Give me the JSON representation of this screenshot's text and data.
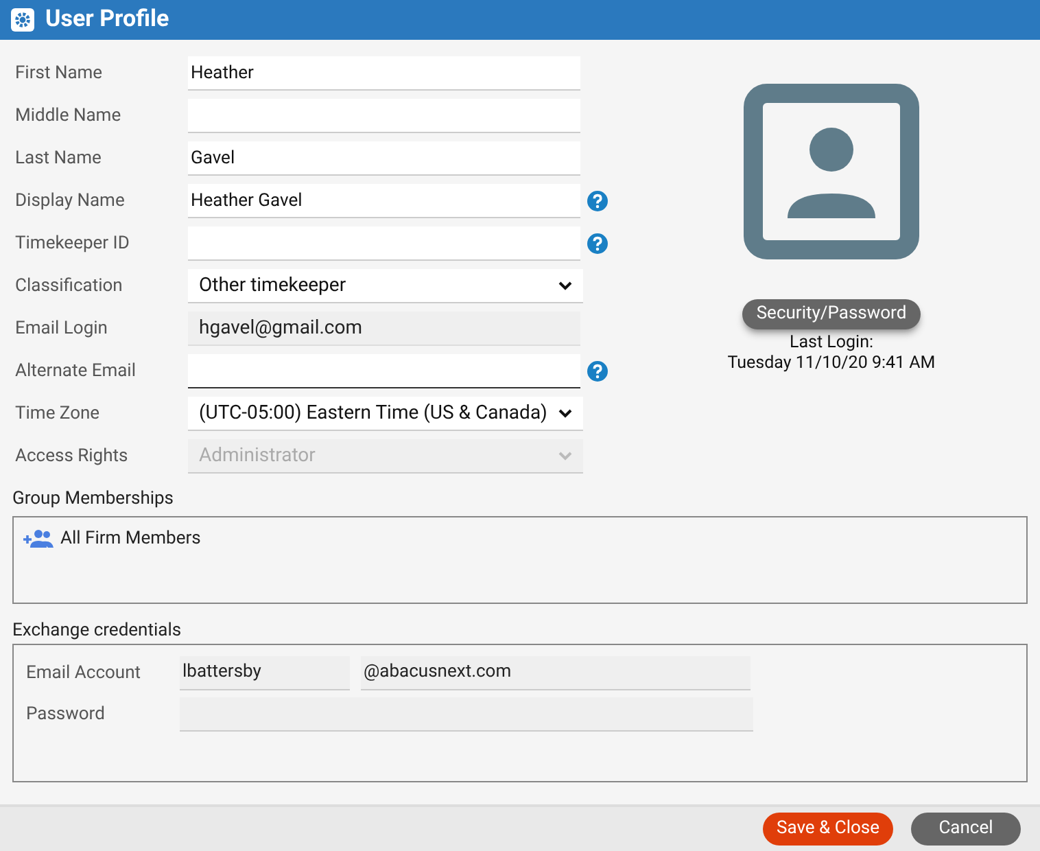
{
  "window": {
    "title": "User Profile"
  },
  "fields": [
    {
      "label": "First Name",
      "kind": "text",
      "value": "Heather",
      "help": false,
      "focused": false
    },
    {
      "label": "Middle Name",
      "kind": "text",
      "help": false,
      "focused": false
    },
    {
      "label": "Last Name",
      "kind": "text",
      "value": "Gavel",
      "help": false,
      "focused": false
    },
    {
      "label": "Display Name",
      "kind": "text",
      "value": "Heather Gavel",
      "help": true,
      "focused": false
    },
    {
      "label": "Timekeeper ID",
      "kind": "text",
      "help": true,
      "focused": false
    },
    {
      "label": "Classification",
      "kind": "select",
      "value": "Other timekeeper",
      "help": false,
      "focused": false
    },
    {
      "label": "Email Login",
      "kind": "readonly",
      "value": "hgavel@gmail.com",
      "help": false,
      "focused": false
    },
    {
      "label": "Alternate Email",
      "kind": "text",
      "help": true,
      "focused": true
    },
    {
      "label": "Time Zone",
      "kind": "select",
      "value": "(UTC-05:00) Eastern Time (US & Canada)",
      "help": false,
      "focused": false
    },
    {
      "label": "Access Rights",
      "kind": "disabled_select",
      "value": "Administrator",
      "help": false,
      "focused": false
    }
  ],
  "profile": {
    "security_button": "Security/Password",
    "last_login_label": "Last Login:",
    "last_login": "Tuesday 11/10/20 9:41 AM"
  },
  "group_memberships": {
    "title": "Group Memberships",
    "items": [
      "All Firm Members"
    ]
  },
  "exchange": {
    "title": "Exchange credentials",
    "email_label": "Email Account",
    "email_user": "lbattersby",
    "email_domain": "@abacusnext.com",
    "password_label": "Password"
  },
  "buttons": {
    "save": "Save & Close",
    "cancel": "Cancel"
  }
}
